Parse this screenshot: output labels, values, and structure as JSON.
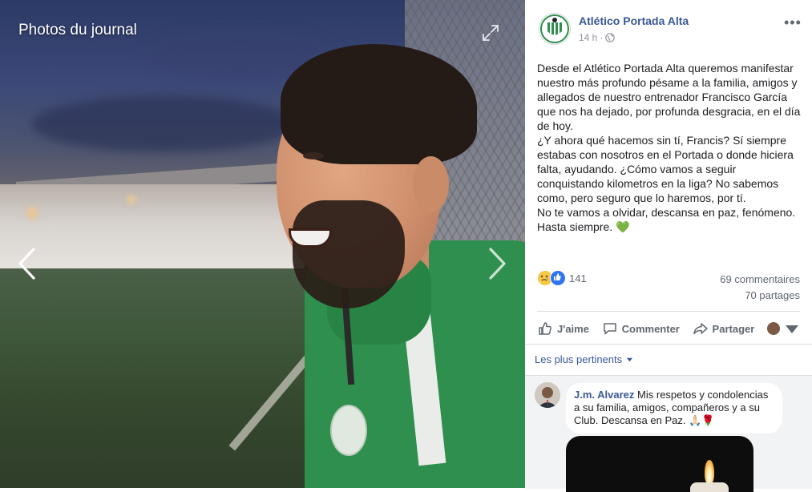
{
  "viewer": {
    "title": "Photos du journal",
    "icons": {
      "expand": "expand-icon",
      "prev": "chevron-left-icon",
      "next": "chevron-right-icon"
    }
  },
  "post": {
    "page_name": "Atlético Portada Alta",
    "time": "14 h",
    "separator": "·",
    "more": "•••",
    "text": "Desde el Atlético Portada Alta queremos manifestar nuestro más profundo pésame a la familia, amigos y allegados de nuestro entrenador Francisco García que nos ha dejado, por profunda desgracia, en el día de hoy.\n¿Y ahora qué hacemos sin tí, Francis? Sí siempre estabas con nosotros en el Portada o donde hiciera falta, ayudando. ¿Cómo vamos a seguir conquistando kilometros en la liga? No sabemos como, pero seguro que lo haremos, por tí.\nNo te vamos a olvidar, descansa en paz, fenómeno. Hasta siempre. 💚",
    "reaction_count": "141",
    "comments_count": "69 commentaires",
    "shares_count": "70 partages"
  },
  "actions": {
    "like": "J'aime",
    "comment": "Commenter",
    "share": "Partager"
  },
  "comments": {
    "sort_label": "Les plus pertinents",
    "items": [
      {
        "author": "J.m. Alvarez",
        "text": "Mis respetos y condolencias a su familia, amigos, compañeros y a su Club. Descansa en Paz. 🙏🏻🌹"
      }
    ]
  },
  "colors": {
    "link": "#385898",
    "secondary_text": "#606770",
    "like_blue": "#2f74f2",
    "jersey_green": "#2f8f4e"
  }
}
